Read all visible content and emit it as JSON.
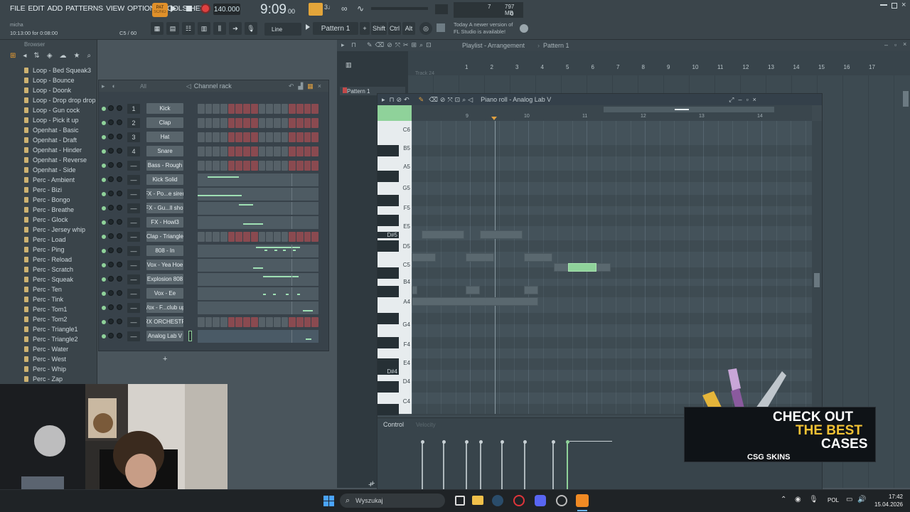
{
  "menu": [
    "FILE",
    "EDIT",
    "ADD",
    "PATTERNS",
    "VIEW",
    "OPTIONS",
    "TOOLS",
    "HELP"
  ],
  "transport": {
    "pat_label": "PAT",
    "song_label": "SONG",
    "tempo": "140.000",
    "time": "9:09",
    "time_sub": "00",
    "cpu": "7",
    "mem": "797 MB",
    "mem_sub": "0"
  },
  "hint": {
    "user": "micha",
    "elapsed": "10:13:00 for 0:08:00",
    "counter": "C5 / 60"
  },
  "toolbar": {
    "snap": "Line",
    "pattern": "Pattern 1",
    "shift": "Shift",
    "ctrl": "Ctrl",
    "alt": "Alt"
  },
  "news": {
    "line1": "Today  A newer version of",
    "line2": "FL Studio is available!"
  },
  "browser": {
    "title": "Browser",
    "items": [
      "Loop - Bed Squeak3",
      "Loop - Bounce",
      "Loop - Doonk",
      "Loop - Drop drop drop",
      "Loop - Gun cock",
      "Loop - Pick it up",
      "Openhat - Basic",
      "Openhat - Draft",
      "Openhat - Hinder",
      "Openhat - Reverse",
      "Openhat - Side",
      "Perc - Ambient",
      "Perc - Bizi",
      "Perc - Bongo",
      "Perc - Breathe",
      "Perc - Glock",
      "Perc - Jersey whip",
      "Perc - Load",
      "Perc - Ping",
      "Perc - Reload",
      "Perc - Scratch",
      "Perc - Squeak",
      "Perc - Ten",
      "Perc - Tink",
      "Perc - Tom1",
      "Perc - Tom2",
      "Perc - Triangle1",
      "Perc - Triangle2",
      "Perc - Water",
      "Perc - West",
      "Perc - Whip",
      "Perc - Zap"
    ]
  },
  "channel_rack": {
    "title": "Channel rack",
    "filter": "All",
    "add": "+",
    "channels": [
      {
        "num": "1",
        "name": "Kick",
        "kind": "steps"
      },
      {
        "num": "2",
        "name": "Clap",
        "kind": "steps"
      },
      {
        "num": "3",
        "name": "Hat",
        "kind": "steps"
      },
      {
        "num": "4",
        "name": "Snare",
        "kind": "steps"
      },
      {
        "num": "—",
        "name": "Bass - Rough",
        "kind": "steps"
      },
      {
        "num": "—",
        "name": "Kick Solid",
        "kind": "roll"
      },
      {
        "num": "—",
        "name": "FX - Po...e siren",
        "kind": "roll"
      },
      {
        "num": "—",
        "name": "FX - Gu...ll shot",
        "kind": "roll"
      },
      {
        "num": "—",
        "name": "FX - Howl3",
        "kind": "roll"
      },
      {
        "num": "—",
        "name": "Clap - Triangle",
        "kind": "steps"
      },
      {
        "num": "—",
        "name": "808 - In",
        "kind": "roll"
      },
      {
        "num": "—",
        "name": "Vox - Yea Hoe",
        "kind": "roll"
      },
      {
        "num": "—",
        "name": "Explosion 808",
        "kind": "roll"
      },
      {
        "num": "—",
        "name": "Vox - Ee",
        "kind": "roll"
      },
      {
        "num": "—",
        "name": "Vox - F...club up",
        "kind": "roll"
      },
      {
        "num": "—",
        "name": "SRX ORCHESTRA",
        "kind": "steps"
      },
      {
        "num": "—",
        "name": "Analog Lab V",
        "kind": "roll"
      }
    ]
  },
  "playlist": {
    "title": "Playlist - Arrangement",
    "pattern": "Pattern 1",
    "picker_item": "Pattern 1",
    "bars": [
      "1",
      "2",
      "3",
      "4",
      "5",
      "6",
      "7",
      "8",
      "9",
      "10",
      "11",
      "12",
      "13",
      "14",
      "15",
      "16",
      "17"
    ],
    "track": "Track 24"
  },
  "piano_roll": {
    "title": "Piano roll - Analog Lab V",
    "bars": [
      "9",
      "10",
      "11",
      "12",
      "13",
      "14"
    ],
    "key_labels": [
      "C6",
      "B5",
      "A5",
      "G5",
      "F5",
      "E5",
      "D#5",
      "D5",
      "C5",
      "B4",
      "A4",
      "G4",
      "F4",
      "E4",
      "D#4",
      "D4",
      "C4"
    ],
    "control_label": "Control",
    "control_sub": "Velocity"
  },
  "taskbar": {
    "search_placeholder": "Wyszukaj",
    "lang": "POL",
    "time": "17:42",
    "date": "15.04.2026"
  },
  "ad": {
    "line1": "CHECK OUT",
    "line2": "THE BEST",
    "line3": "CASES",
    "brand": "CSG SKINS"
  },
  "colors": {
    "accent": "#f0a030",
    "note": "#8fd29a",
    "record": "#e04040"
  }
}
